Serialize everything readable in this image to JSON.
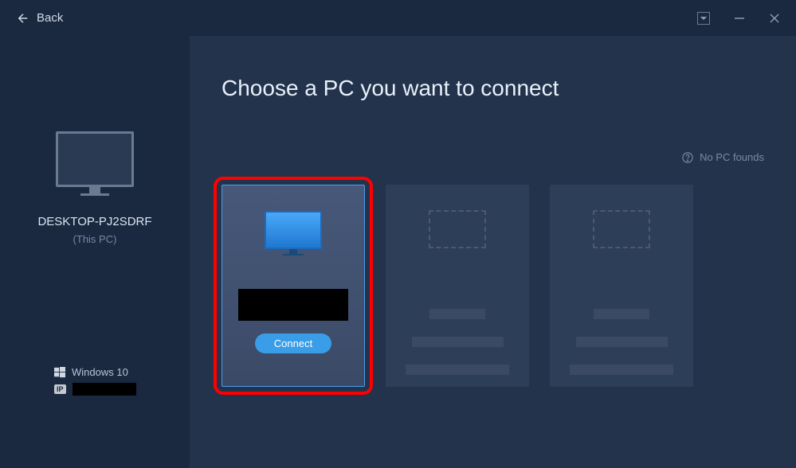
{
  "titlebar": {
    "back_label": "Back"
  },
  "sidebar": {
    "pc_name": "DESKTOP-PJ2SDRF",
    "this_pc_label": "(This PC)",
    "os_label": "Windows 10",
    "ip_badge": "IP",
    "ip_value": ""
  },
  "main": {
    "title": "Choose a PC you want to connect",
    "no_pc_link": "No PC founds",
    "cards": [
      {
        "type": "available",
        "name_redacted": true,
        "connect_label": "Connect"
      },
      {
        "type": "placeholder"
      },
      {
        "type": "placeholder"
      }
    ]
  }
}
